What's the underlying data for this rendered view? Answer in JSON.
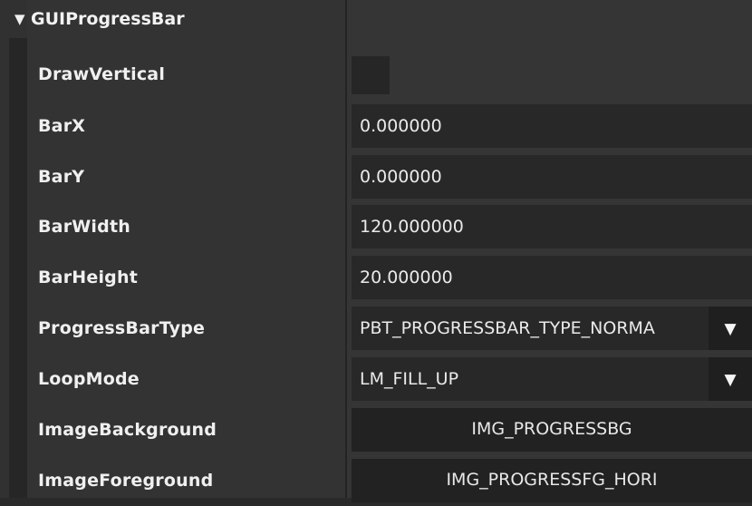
{
  "component": {
    "title": "GUIProgressBar",
    "expand_icon": "triangle-down-icon"
  },
  "properties": [
    {
      "label": "DrawVertical",
      "type": "checkbox",
      "checked": false
    },
    {
      "label": "BarX",
      "type": "text",
      "value": "0.000000"
    },
    {
      "label": "BarY",
      "type": "text",
      "value": "0.000000"
    },
    {
      "label": "BarWidth",
      "type": "text",
      "value": "120.000000"
    },
    {
      "label": "BarHeight",
      "type": "text",
      "value": "20.000000"
    },
    {
      "label": "ProgressBarType",
      "type": "select",
      "value": "PBT_PROGRESSBAR_TYPE_NORMA"
    },
    {
      "label": "LoopMode",
      "type": "select",
      "value": "LM_FILL_UP"
    },
    {
      "label": "ImageBackground",
      "type": "asset",
      "value": "IMG_PROGRESSBG"
    },
    {
      "label": "ImageForeground",
      "type": "asset",
      "value": "IMG_PROGRESSFG_HORI"
    }
  ],
  "dropdown_glyph": "▼",
  "expand_glyph": "▼"
}
